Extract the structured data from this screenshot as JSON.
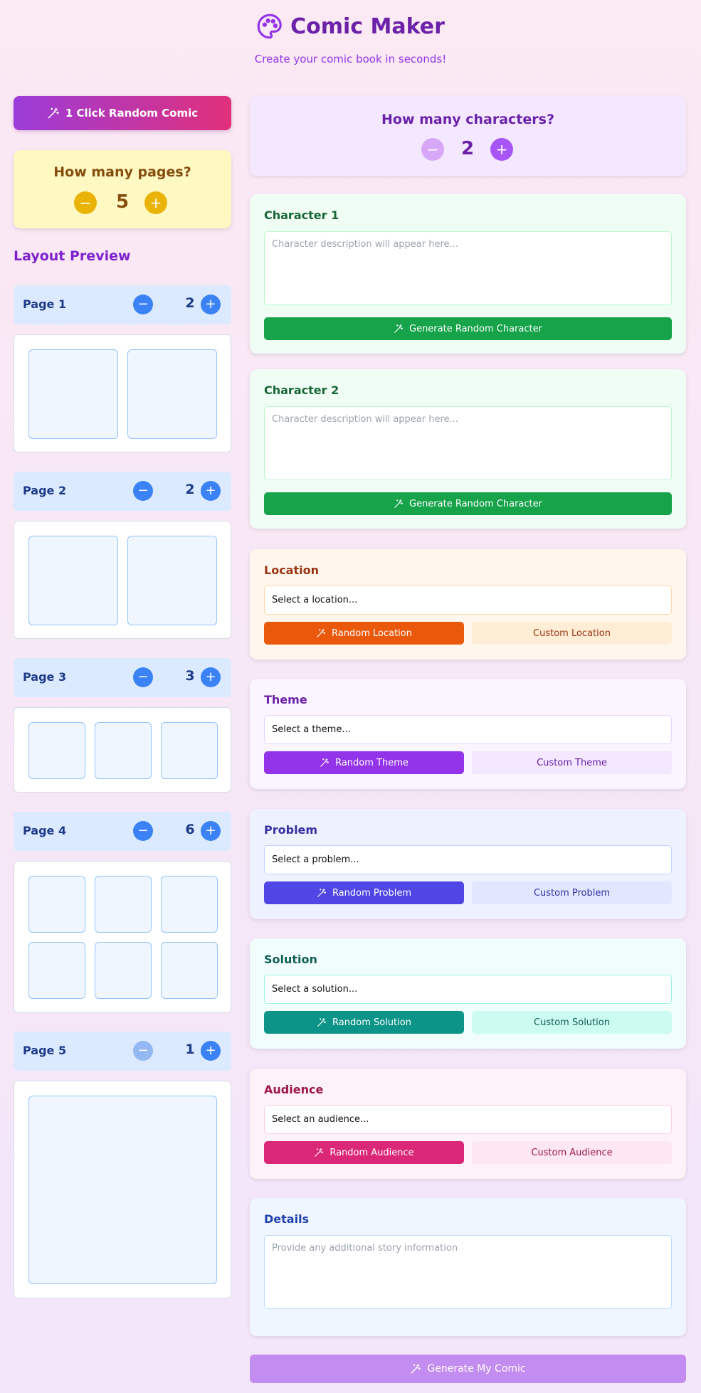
{
  "header": {
    "title": "Comic Maker",
    "subtitle": "Create your comic book in seconds!",
    "icon": "palette-icon"
  },
  "random_comic_button": {
    "label": "1 Click Random Comic",
    "icon": "magic-wand-icon"
  },
  "pages_control": {
    "question": "How many pages?",
    "value": "5",
    "minus": "−",
    "plus": "+"
  },
  "layout_preview": {
    "title": "Layout Preview",
    "pages": [
      {
        "label": "Page 1",
        "panels": "2"
      },
      {
        "label": "Page 2",
        "panels": "2"
      },
      {
        "label": "Page 3",
        "panels": "3"
      },
      {
        "label": "Page 4",
        "panels": "6"
      },
      {
        "label": "Page 5",
        "panels": "1"
      }
    ]
  },
  "characters_control": {
    "question": "How many characters?",
    "value": "2"
  },
  "characters": [
    {
      "title": "Character 1",
      "placeholder": "Character description will appear here...",
      "button": "Generate Random Character"
    },
    {
      "title": "Character 2",
      "placeholder": "Character description will appear here...",
      "button": "Generate Random Character"
    }
  ],
  "location": {
    "title": "Location",
    "select": "Select a location...",
    "random": "Random Location",
    "custom": "Custom Location"
  },
  "theme": {
    "title": "Theme",
    "select": "Select a theme...",
    "random": "Random Theme",
    "custom": "Custom Theme"
  },
  "problem": {
    "title": "Problem",
    "select": "Select a problem...",
    "random": "Random Problem",
    "custom": "Custom Problem"
  },
  "solution": {
    "title": "Solution",
    "select": "Select a solution...",
    "random": "Random Solution",
    "custom": "Custom Solution"
  },
  "audience": {
    "title": "Audience",
    "select": "Select an audience...",
    "random": "Random Audience",
    "custom": "Custom Audience"
  },
  "details": {
    "title": "Details",
    "placeholder": "Provide any additional story information"
  },
  "generate_button": {
    "label": "Generate My Comic"
  },
  "colors": {
    "purple": "#7e22ce",
    "pink": "#db2777",
    "green": "#16a34a",
    "orange": "#ea580c",
    "violet": "#9333ea",
    "indigo": "#4f46e5",
    "teal": "#0d9488",
    "blue": "#3b82f6",
    "yellow": "#eab308"
  }
}
